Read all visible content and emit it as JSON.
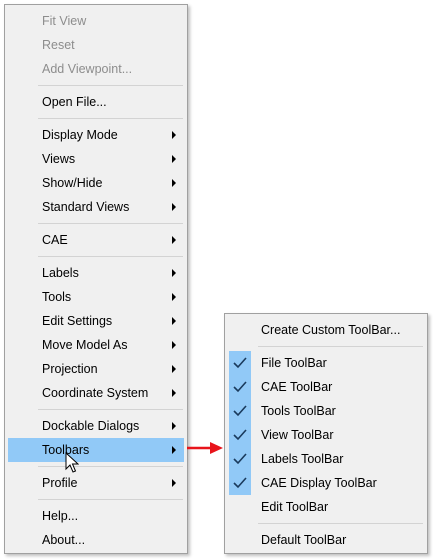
{
  "main_menu": {
    "fit_view": "Fit View",
    "reset": "Reset",
    "add_viewpoint": "Add Viewpoint...",
    "open_file": "Open File...",
    "display_mode": "Display Mode",
    "views": "Views",
    "show_hide": "Show/Hide",
    "standard_views": "Standard Views",
    "cae": "CAE",
    "labels": "Labels",
    "tools": "Tools",
    "edit_settings": "Edit Settings",
    "move_model_as": "Move Model As",
    "projection": "Projection",
    "coordinate_system": "Coordinate System",
    "dockable_dialogs": "Dockable Dialogs",
    "toolbars": "Toolbars",
    "profile": "Profile",
    "help": "Help...",
    "about": "About..."
  },
  "toolbars_submenu": {
    "create_custom": "Create Custom ToolBar...",
    "file_toolbar": "File ToolBar",
    "cae_toolbar": "CAE ToolBar",
    "tools_toolbar": "Tools ToolBar",
    "view_toolbar": "View ToolBar",
    "labels_toolbar": "Labels ToolBar",
    "cae_display_toolbar": "CAE Display ToolBar",
    "edit_toolbar": "Edit ToolBar",
    "default_toolbar": "Default ToolBar"
  },
  "colors": {
    "highlight": "#91c9f7",
    "menu_bg": "#f0f0f0",
    "disabled_text": "#8d8d8d",
    "arrow_red": "#e8141b"
  }
}
